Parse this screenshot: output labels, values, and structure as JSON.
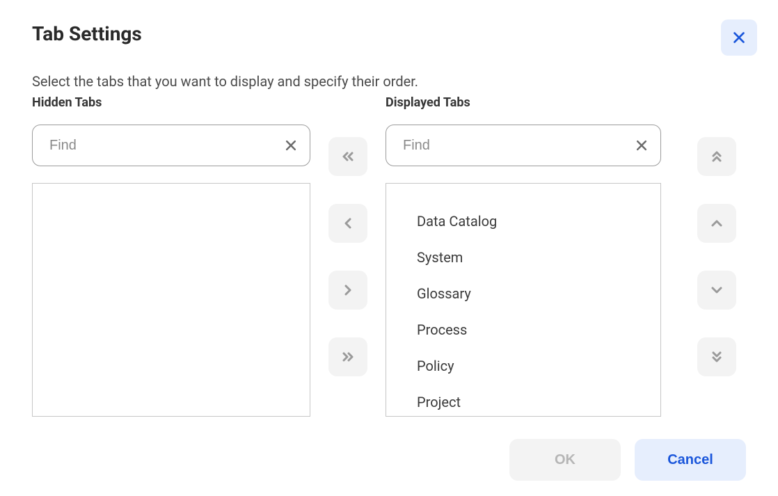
{
  "title": "Tab Settings",
  "instruction": "Select the tabs that you want to display and specify their order.",
  "hidden": {
    "label": "Hidden Tabs",
    "placeholder": "Find",
    "items": []
  },
  "displayed": {
    "label": "Displayed Tabs",
    "placeholder": "Find",
    "items": [
      "Data Catalog",
      "System",
      "Glossary",
      "Process",
      "Policy",
      "Project"
    ]
  },
  "buttons": {
    "ok": "OK",
    "cancel": "Cancel"
  },
  "colors": {
    "accent": "#1a56db",
    "accentBg": "#e6eefd",
    "muted": "#f3f3f3",
    "iconGray": "#8a8a8a"
  }
}
